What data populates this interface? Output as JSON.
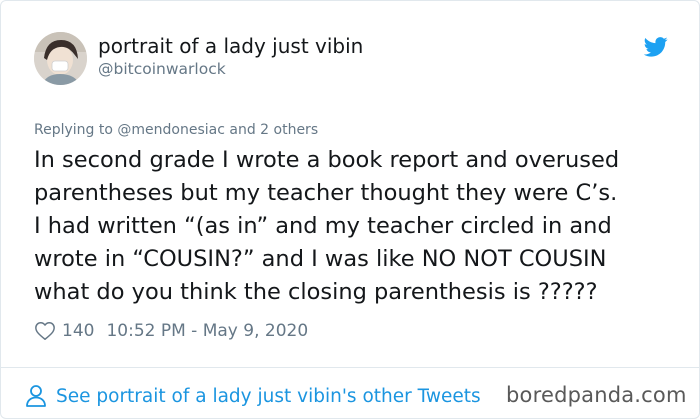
{
  "tweet": {
    "author": {
      "display_name": "portrait of a lady just vibin",
      "handle": "@bitcoinwarlock"
    },
    "reply_prefix": "Replying to",
    "reply_to": "@mendonesiac",
    "reply_suffix": " and 2 others",
    "text_lines": [
      "In second grade I wrote a book report and overused",
      "parentheses but my teacher thought they were C’s.",
      "I had written “(as in” and my teacher circled in and",
      "wrote in “COUSIN?” and I was like NO NOT COUSIN",
      "what do you think the closing parenthesis is ?????"
    ],
    "likes": "140",
    "timestamp": "10:52 PM - May 9, 2020"
  },
  "footer": {
    "link_text": "See portrait of a lady just vibin's other Tweets"
  },
  "watermark": "boredpanda.com",
  "icons": {
    "brand": "twitter-bird-icon",
    "like": "heart-outline-icon",
    "profile": "person-outline-icon"
  },
  "colors": {
    "accent": "#1b95e0",
    "secondary_text": "#657786",
    "primary_text": "#14171a",
    "twitter_blue": "#1da1f2"
  }
}
